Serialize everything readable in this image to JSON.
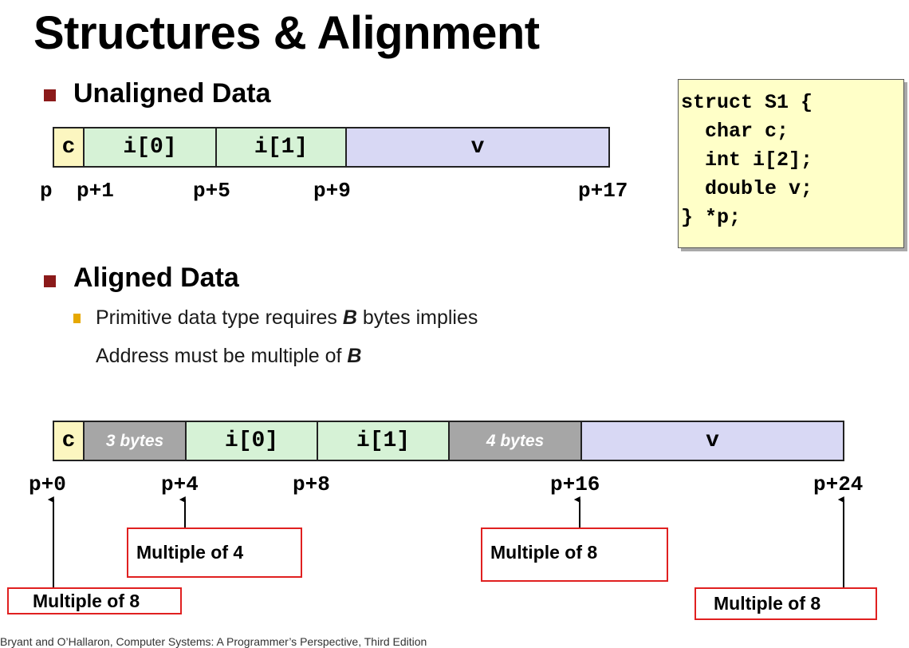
{
  "title": "Structures & Alignment",
  "unaligned": {
    "heading": "Unaligned Data",
    "cells": [
      {
        "label": "c",
        "color": "#fcf6c0"
      },
      {
        "label": "i[0]",
        "color": "#d6f2d6"
      },
      {
        "label": "i[1]",
        "color": "#d6f2d6"
      },
      {
        "label": "v",
        "color": "#d8d8f4"
      }
    ],
    "addresses": [
      "p",
      "p+1",
      "p+5",
      "p+9",
      "p+17"
    ]
  },
  "code": [
    "struct S1 {",
    "  char c;",
    "  int i[2];",
    "  double v;",
    "} *p;"
  ],
  "aligned": {
    "heading": "Aligned Data",
    "rule_line1": "Primitive data type requires ",
    "rule_b1": "B",
    "rule_line1_end": " bytes implies",
    "rule_line2": "Address must be multiple of ",
    "rule_b2": "B",
    "cells": [
      {
        "label": "c",
        "color": "#fcf6c0"
      },
      {
        "label": "3 bytes",
        "color": "#a6a6a6"
      },
      {
        "label": "i[0]",
        "color": "#d6f2d6"
      },
      {
        "label": "i[1]",
        "color": "#d6f2d6"
      },
      {
        "label": "4 bytes",
        "color": "#a6a6a6"
      },
      {
        "label": "v",
        "color": "#d8d8f4"
      }
    ],
    "addresses": [
      "p+0",
      "p+4",
      "p+8",
      "p+16",
      "p+24"
    ],
    "notes": [
      "Multiple of 8",
      "Multiple of 4",
      "Multiple of 8",
      "Multiple of 8"
    ]
  },
  "footer": "Bryant and O’Hallaron, Computer Systems: A Programmer’s Perspective, Third Edition",
  "colors": {
    "bullet": "#8b1a1a",
    "note_border": "#e02020",
    "code_bg": "#ffffc8"
  }
}
